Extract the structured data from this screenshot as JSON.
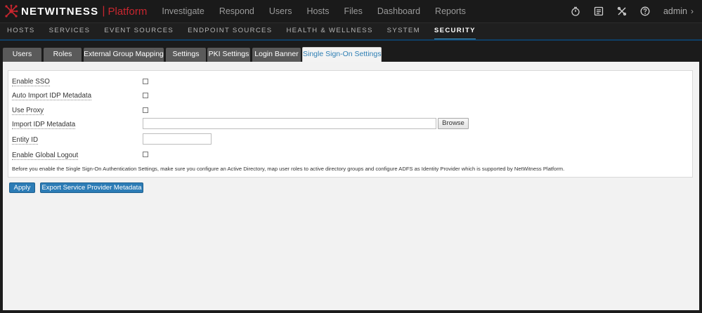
{
  "brand": {
    "name": "NETWITNESS",
    "platform": "Platform",
    "logo_icon": "netwitness-logo-icon",
    "accent_color": "#c8262f"
  },
  "main_nav": [
    {
      "label": "Investigate"
    },
    {
      "label": "Respond"
    },
    {
      "label": "Users"
    },
    {
      "label": "Hosts"
    },
    {
      "label": "Files"
    },
    {
      "label": "Dashboard"
    },
    {
      "label": "Reports"
    }
  ],
  "utility_icons": [
    "stopwatch-icon",
    "checklist-icon",
    "tools-icon",
    "help-icon"
  ],
  "user": {
    "name": "admin",
    "chevron": "›"
  },
  "sub_nav": [
    {
      "label": "HOSTS",
      "active": false
    },
    {
      "label": "SERVICES",
      "active": false
    },
    {
      "label": "EVENT SOURCES",
      "active": false
    },
    {
      "label": "ENDPOINT SOURCES",
      "active": false
    },
    {
      "label": "HEALTH & WELLNESS",
      "active": false
    },
    {
      "label": "SYSTEM",
      "active": false
    },
    {
      "label": "SECURITY",
      "active": true
    }
  ],
  "tabs": [
    {
      "label": "Users",
      "active": false
    },
    {
      "label": "Roles",
      "active": false
    },
    {
      "label": "External Group Mapping",
      "active": false
    },
    {
      "label": "Settings",
      "active": false
    },
    {
      "label": "PKI Settings",
      "active": false
    },
    {
      "label": "Login Banner",
      "active": false
    },
    {
      "label": "Single Sign-On Settings",
      "active": true
    }
  ],
  "form": {
    "enable_sso": {
      "label": "Enable SSO",
      "checked": false
    },
    "auto_import": {
      "label": "Auto Import IDP Metadata",
      "checked": false
    },
    "use_proxy": {
      "label": "Use Proxy",
      "checked": false
    },
    "import_idp": {
      "label": "Import IDP Metadata",
      "value": "",
      "browse_label": "Browse"
    },
    "entity_id": {
      "label": "Entity ID",
      "value": ""
    },
    "global_logout": {
      "label": "Enable Global Logout",
      "checked": false
    },
    "note": "Before you enable the Single Sign-On Authentication Settings, make sure you configure an Active Directory, map user roles to active directory groups and configure ADFS as Identity Provider which is supported by NetWitness Platform."
  },
  "actions": {
    "apply_label": "Apply",
    "export_label": "Export Service Provider Metadata"
  }
}
